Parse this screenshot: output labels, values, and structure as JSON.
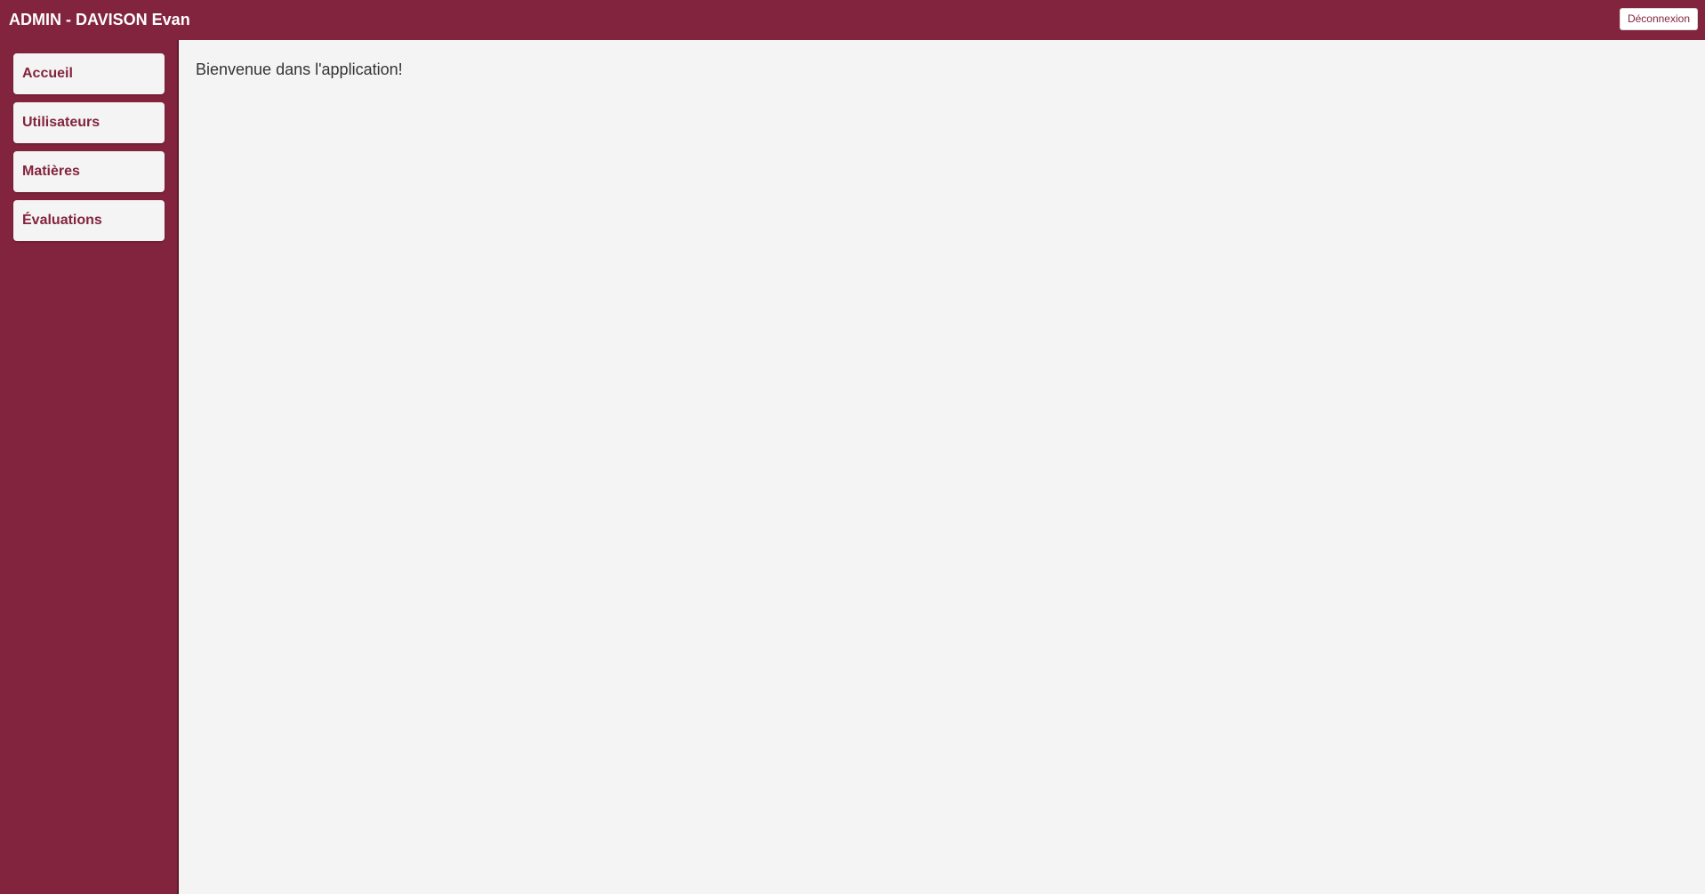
{
  "header": {
    "title": "ADMIN - DAVISON Evan",
    "logout_label": "Déconnexion"
  },
  "sidebar": {
    "items": [
      {
        "label": "Accueil"
      },
      {
        "label": "Utilisateurs"
      },
      {
        "label": "Matières"
      },
      {
        "label": "Évaluations"
      }
    ]
  },
  "main": {
    "welcome_text": "Bienvenue dans l'application!"
  },
  "colors": {
    "brand": "#83243e",
    "background": "#f4f4f4"
  }
}
